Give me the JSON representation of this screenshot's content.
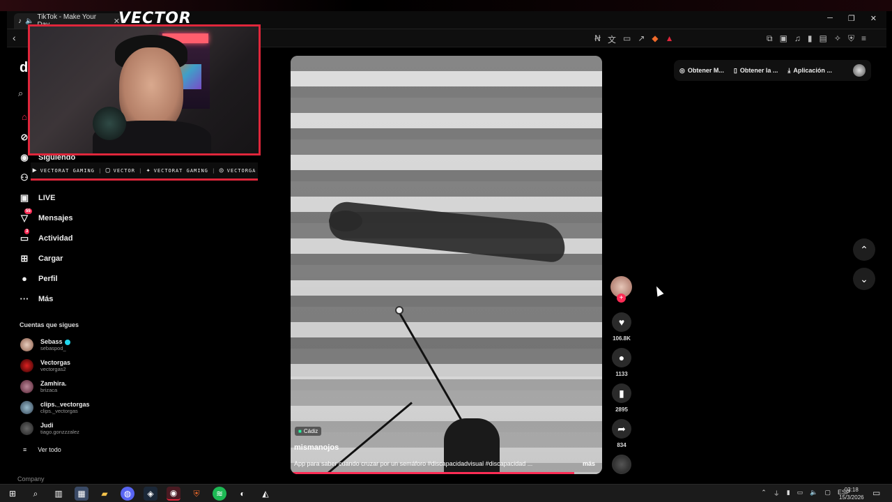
{
  "browser": {
    "tab_title": "TikTok - Make Your Day",
    "tab_close": "✕",
    "win_minimize": "─",
    "win_restore": "❐",
    "win_close": "✕"
  },
  "overlay": {
    "streamer_logo": "VECTOR",
    "social": [
      {
        "icon": "youtube-icon",
        "glyph": "▶",
        "label": "VECTORAT GAMING"
      },
      {
        "icon": "twitch-icon",
        "glyph": "▢",
        "label": "VECTOR"
      },
      {
        "icon": "twitter-icon",
        "glyph": "✦",
        "label": "VECTORAT GAMING"
      },
      {
        "icon": "instagram-icon",
        "glyph": "◎",
        "label": "VECTORGA"
      }
    ]
  },
  "sidebar": {
    "logo": "d",
    "items": [
      {
        "label": "Siguiendo",
        "icon": "following-icon",
        "glyph": "◉",
        "badge": ""
      },
      {
        "label": "",
        "icon": "friends-icon",
        "glyph": "⚇",
        "badge": ""
      },
      {
        "label": "LIVE",
        "icon": "live-icon",
        "glyph": "▣",
        "badge": ""
      },
      {
        "label": "Mensajes",
        "icon": "messages-icon",
        "glyph": "▽",
        "badge": "55"
      },
      {
        "label": "Actividad",
        "icon": "activity-icon",
        "glyph": "▭",
        "badge": "3"
      },
      {
        "label": "Cargar",
        "icon": "upload-icon",
        "glyph": "⊞",
        "badge": ""
      },
      {
        "label": "Perfil",
        "icon": "profile-icon",
        "glyph": "●",
        "badge": ""
      },
      {
        "label": "Más",
        "icon": "more-icon",
        "glyph": "···",
        "badge": ""
      }
    ],
    "following_title": "Cuentas que sigues",
    "accounts": [
      {
        "name": "Sebass",
        "handle": "sebaspod_",
        "verified": true
      },
      {
        "name": "Vectorgas",
        "handle": "vectorgas2",
        "verified": false
      },
      {
        "name": "Zamhira.",
        "handle": "brizaca",
        "verified": false
      },
      {
        "name": "clips._vectorgas",
        "handle": "clips._vectorgas",
        "verified": false
      },
      {
        "name": "Judi",
        "handle": "tiago.gonzzzalez",
        "verified": false
      }
    ],
    "see_all": "Ver todo",
    "company": "Company"
  },
  "video": {
    "location": "Cádiz",
    "author": "mismanojos",
    "caption": "App para saber cuando cruzar por un semáforo #discapacidadvisual #discapacidad ...",
    "more_label": "más",
    "progress": 0.91
  },
  "actions": {
    "likes": "106.8K",
    "comments": "1133",
    "saves": "2895",
    "shares": "834"
  },
  "top_right": {
    "btn1": "Obtener M...",
    "btn2": "Obtener la ...",
    "btn3": "Aplicación ..."
  },
  "taskbar": {
    "lang": "ESP",
    "time": "03:18",
    "date": "15/3/2026"
  },
  "colors": {
    "accent": "#fe2c55",
    "overlay_red": "#e0263b"
  }
}
